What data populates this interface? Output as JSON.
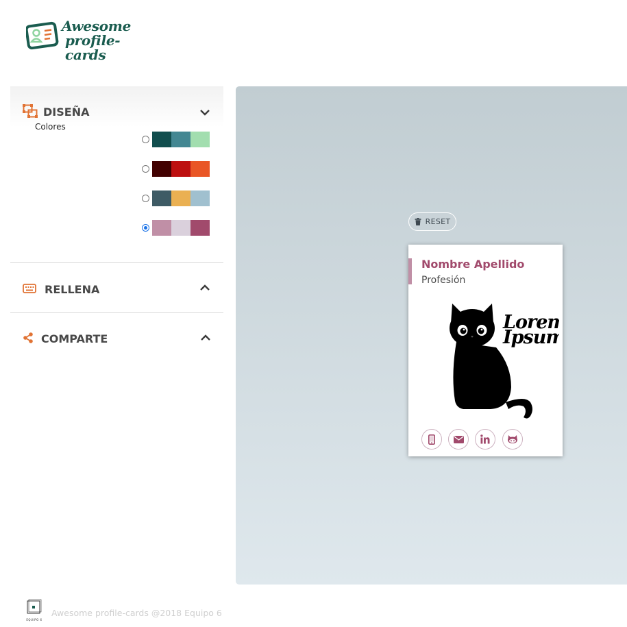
{
  "header": {
    "logo_line1": "Awesome",
    "logo_line2": "profile-cards"
  },
  "sidebar": {
    "design": {
      "title": "DISEÑA",
      "colors_label": "Colores",
      "expanded": true,
      "palettes": [
        {
          "colors": [
            "#114e4e",
            "#438792",
            "#a2deaf"
          ],
          "selected": false
        },
        {
          "colors": [
            "#420101",
            "#bd1010",
            "#e95626"
          ],
          "selected": false
        },
        {
          "colors": [
            "#3e5b65",
            "#eab052",
            "#a0c0cf"
          ],
          "selected": false
        },
        {
          "colors": [
            "#c08fa6",
            "#dad0dc",
            "#a14a6c"
          ],
          "selected": true
        }
      ]
    },
    "fill": {
      "title": "RELLENA",
      "expanded": false
    },
    "share": {
      "title": "COMPARTE",
      "expanded": false
    }
  },
  "preview": {
    "reset_label": "RESET",
    "card": {
      "name": "Nombre Apellido",
      "job": "Profesión",
      "image_text_1": "Lorem",
      "image_text_2": "Ipsum",
      "social_icons": [
        "phone-icon",
        "email-icon",
        "linkedin-icon",
        "github-icon"
      ]
    }
  },
  "footer": {
    "text": "Awesome profile-cards @2018 Equipo 6",
    "badge": "EQUIPO 6"
  },
  "colors": {
    "accent_orange": "#e17334",
    "brand_green": "#1a5c4f",
    "card_accent": "#a14a6c"
  }
}
